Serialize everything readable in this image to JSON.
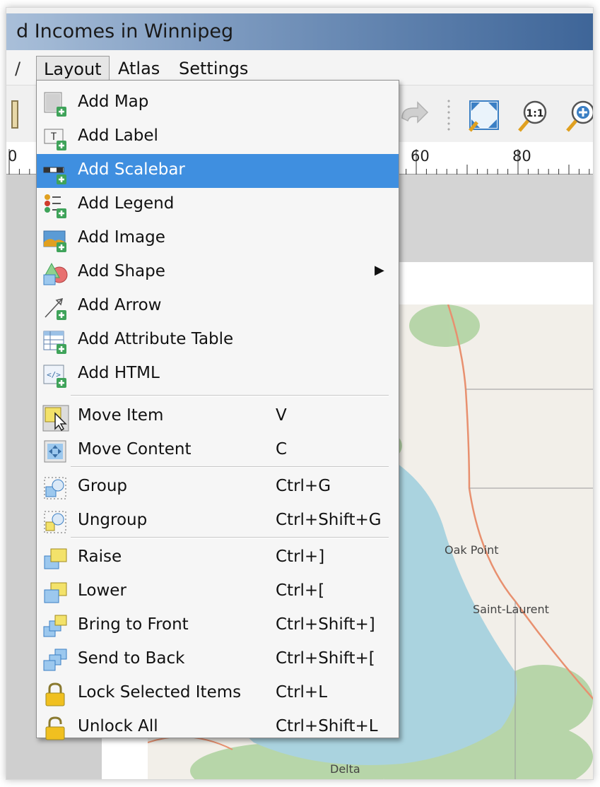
{
  "window": {
    "title": "d Incomes in Winnipeg"
  },
  "menubar": {
    "prev_item": "/",
    "items": [
      "Layout",
      "Atlas",
      "Settings"
    ],
    "active": "Layout"
  },
  "ruler": {
    "labels": [
      "0",
      "60",
      "80"
    ]
  },
  "map": {
    "places": [
      "Oak Point",
      "Saint-Laurent",
      "Delta"
    ]
  },
  "layout_menu": {
    "highlighted_item": "Add Scalebar",
    "items": [
      {
        "label": "Add Map",
        "icon": "add-map-icon"
      },
      {
        "label": "Add Label",
        "icon": "add-label-icon"
      },
      {
        "label": "Add Scalebar",
        "icon": "add-scalebar-icon"
      },
      {
        "label": "Add Legend",
        "icon": "add-legend-icon"
      },
      {
        "label": "Add Image",
        "icon": "add-image-icon"
      },
      {
        "label": "Add Shape",
        "icon": "add-shape-icon",
        "submenu": true
      },
      {
        "label": "Add Arrow",
        "icon": "add-arrow-icon"
      },
      {
        "label": "Add Attribute Table",
        "icon": "add-attribute-table-icon"
      },
      {
        "label": "Add HTML",
        "icon": "add-html-icon"
      },
      {
        "label": "Move Item",
        "icon": "move-item-icon",
        "shortcut": "V"
      },
      {
        "label": "Move Content",
        "icon": "move-content-icon",
        "shortcut": "C"
      },
      {
        "label": "Group",
        "icon": "group-icon",
        "shortcut": "Ctrl+G"
      },
      {
        "label": "Ungroup",
        "icon": "ungroup-icon",
        "shortcut": "Ctrl+Shift+G"
      },
      {
        "label": "Raise",
        "icon": "raise-icon",
        "shortcut": "Ctrl+]"
      },
      {
        "label": "Lower",
        "icon": "lower-icon",
        "shortcut": "Ctrl+["
      },
      {
        "label": "Bring to Front",
        "icon": "bring-to-front-icon",
        "shortcut": "Ctrl+Shift+]"
      },
      {
        "label": "Send to Back",
        "icon": "send-to-back-icon",
        "shortcut": "Ctrl+Shift+["
      },
      {
        "label": "Lock Selected Items",
        "icon": "lock-icon",
        "shortcut": "Ctrl+L"
      },
      {
        "label": "Unlock All",
        "icon": "unlock-icon",
        "shortcut": "Ctrl+Shift+L"
      }
    ]
  },
  "colors": {
    "highlight": "#3f8fe0",
    "titlebar": "#5b7eab",
    "lake": "#aad3df",
    "land": "#f2efe9",
    "vegetation": "#add19e",
    "road": "#e8906f"
  }
}
